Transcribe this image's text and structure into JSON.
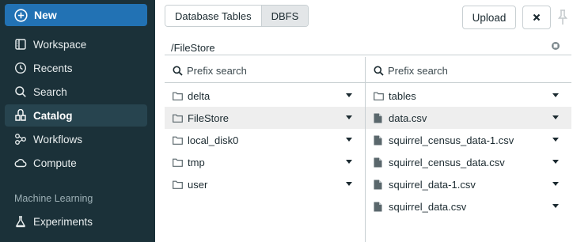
{
  "sidebar": {
    "new_label": "New",
    "items": [
      {
        "label": "Workspace",
        "icon": "workspace-icon"
      },
      {
        "label": "Recents",
        "icon": "clock-icon"
      },
      {
        "label": "Search",
        "icon": "search-icon"
      },
      {
        "label": "Catalog",
        "icon": "catalog-icon",
        "active": true
      },
      {
        "label": "Workflows",
        "icon": "workflows-icon"
      },
      {
        "label": "Compute",
        "icon": "cloud-icon"
      }
    ],
    "section_label": "Machine Learning",
    "ml_items": [
      {
        "label": "Experiments",
        "icon": "flask-icon"
      }
    ]
  },
  "toolbar": {
    "tabs": [
      "Database Tables",
      "DBFS"
    ],
    "selected_tab": "DBFS",
    "upload_label": "Upload"
  },
  "path": "/FileStore",
  "left_pane": {
    "search_placeholder": "Prefix search",
    "items": [
      "delta",
      "FileStore",
      "local_disk0",
      "tmp",
      "user"
    ],
    "selected": "FileStore"
  },
  "right_pane": {
    "search_placeholder": "Prefix search",
    "items": [
      "tables",
      "data.csv",
      "squirrel_census_data-1.csv",
      "squirrel_census_data.csv",
      "squirrel_data-1.csv",
      "squirrel_data.csv"
    ],
    "selected": "data.csv"
  },
  "colors": {
    "sidebar_bg": "#1b3139",
    "new_button": "#2272b4",
    "active_nav": "#27444f",
    "selected_row": "#eeeeee"
  }
}
